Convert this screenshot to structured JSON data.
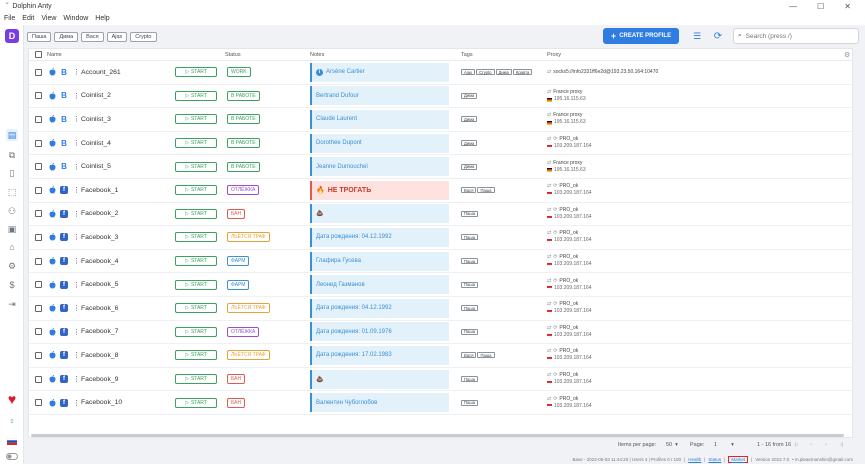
{
  "window": {
    "title": "Dolphin Anty",
    "min": "—",
    "max": "☐",
    "close": "✕"
  },
  "menu": [
    "File",
    "Edit",
    "View",
    "Window",
    "Help"
  ],
  "sidebar": {
    "logo": "D"
  },
  "toolbar": {
    "tag_filters": [
      "Паша",
      "Дима",
      "Вася",
      "Ajax",
      "Crypto"
    ],
    "create_label": "CREATE PROFILE",
    "search_placeholder": "Search (press /)"
  },
  "table": {
    "columns": {
      "name": "Name",
      "status": "Status",
      "notes": "Notes",
      "tags": "Tags",
      "proxy": "Proxy"
    },
    "start_label": "START",
    "rows": [
      {
        "name": "Account_261",
        "browser": "B",
        "status": "WORK",
        "status_color": "#3aa15f",
        "note": "Arsène Cartier",
        "note_icon": "info",
        "note_warn": false,
        "tags": [
          "Ajax",
          "Crypto",
          "Дима",
          "Кравта"
        ],
        "proxy_1": "socks5://info2331ff6e2d@193.23.50.164:10470",
        "proxy_2": "",
        "proxy_flag": "none"
      },
      {
        "name": "Coinlist_2",
        "browser": "B",
        "status": "В РАБОТЕ",
        "status_color": "#3aa15f",
        "note": "Bertrand Dufour",
        "note_icon": "",
        "note_warn": false,
        "tags": [
          "Дима"
        ],
        "proxy_1": "France proxy",
        "proxy_2": "195.16.115.63",
        "proxy_flag": "de"
      },
      {
        "name": "Coinlist_3",
        "browser": "B",
        "status": "В РАБОТЕ",
        "status_color": "#3aa15f",
        "note": "Claude Laurent",
        "note_icon": "",
        "note_warn": false,
        "tags": [
          "Дима"
        ],
        "proxy_1": "France proxy",
        "proxy_2": "195.16.115.63",
        "proxy_flag": "de"
      },
      {
        "name": "Coinlist_4",
        "browser": "B",
        "status": "В РАБОТЕ",
        "status_color": "#3aa15f",
        "note": "Dorothée Dupont",
        "note_icon": "",
        "note_warn": false,
        "tags": [
          "Дима"
        ],
        "proxy_1": "PRO_ok",
        "proxy_2": "103.209.187.164",
        "proxy_flag": "id"
      },
      {
        "name": "Coinlist_5",
        "browser": "B",
        "status": "В РАБОТЕ",
        "status_color": "#3aa15f",
        "note": "Jeanne Dumouchel",
        "note_icon": "",
        "note_warn": false,
        "tags": [
          "Дима"
        ],
        "proxy_1": "France proxy",
        "proxy_2": "195.16.115.63",
        "proxy_flag": "de"
      },
      {
        "name": "Facebook_1",
        "browser": "f",
        "status": "ОТЛЁЖКА",
        "status_color": "#9b4dca",
        "note": "НЕ ТРОГАТЬ",
        "note_icon": "fire",
        "note_warn": true,
        "tags": [
          "Вася",
          "Паша"
        ],
        "proxy_1": "PRO_ok",
        "proxy_2": "103.209.187.164",
        "proxy_flag": "id"
      },
      {
        "name": "Facebook_2",
        "browser": "f",
        "status": "БАН",
        "status_color": "#e25a4e",
        "note": "💩",
        "note_icon": "",
        "note_warn": false,
        "tags": [
          "Паша"
        ],
        "proxy_1": "PRO_ok",
        "proxy_2": "103.209.187.164",
        "proxy_flag": "id"
      },
      {
        "name": "Facebook_3",
        "browser": "f",
        "status": "ЛЬЁТСЯ ТРАФ",
        "status_color": "#e8a23a",
        "note": "Дата рождения: 04.12.1992",
        "note_icon": "",
        "note_warn": false,
        "tags": [
          "Паша"
        ],
        "proxy_1": "PRO_ok",
        "proxy_2": "103.209.187.164",
        "proxy_flag": "id"
      },
      {
        "name": "Facebook_4",
        "browser": "f",
        "status": "ФАРМ",
        "status_color": "#3a8fd6",
        "note": "Глафира Гусева",
        "note_icon": "",
        "note_warn": false,
        "tags": [
          "Паша"
        ],
        "proxy_1": "PRO_ok",
        "proxy_2": "103.209.187.164",
        "proxy_flag": "id"
      },
      {
        "name": "Facebook_5",
        "browser": "f",
        "status": "ФАРМ",
        "status_color": "#3a8fd6",
        "note": "Леонид Газманов",
        "note_icon": "",
        "note_warn": false,
        "tags": [
          "Паша"
        ],
        "proxy_1": "PRO_ok",
        "proxy_2": "103.209.187.164",
        "proxy_flag": "id"
      },
      {
        "name": "Facebook_6",
        "browser": "f",
        "status": "ЛЬЁТСЯ ТРАФ",
        "status_color": "#e8a23a",
        "note": "Дата рождения: 04.12.1992",
        "note_icon": "",
        "note_warn": false,
        "tags": [
          "Паша"
        ],
        "proxy_1": "PRO_ok",
        "proxy_2": "103.209.187.164",
        "proxy_flag": "id"
      },
      {
        "name": "Facebook_7",
        "browser": "f",
        "status": "ОТЛЁЖКА",
        "status_color": "#9b4dca",
        "note": "Дата рождения: 01.09.1976",
        "note_icon": "",
        "note_warn": false,
        "tags": [
          "Паша"
        ],
        "proxy_1": "PRO_ok",
        "proxy_2": "103.209.187.164",
        "proxy_flag": "id"
      },
      {
        "name": "Facebook_8",
        "browser": "f",
        "status": "ЛЬЁТСЯ ТРАФ",
        "status_color": "#e8a23a",
        "note": "Дата рождения: 17.02.1983",
        "note_icon": "",
        "note_warn": false,
        "tags": [
          "Вася",
          "Паша"
        ],
        "proxy_1": "PRO_ok",
        "proxy_2": "103.209.187.164",
        "proxy_flag": "id"
      },
      {
        "name": "Facebook_9",
        "browser": "f",
        "status": "БАН",
        "status_color": "#e25a4e",
        "note": "💩",
        "note_icon": "",
        "note_warn": false,
        "tags": [
          "Паша"
        ],
        "proxy_1": "PRO_ok",
        "proxy_2": "103.209.187.164",
        "proxy_flag": "id"
      },
      {
        "name": "Facebook_10",
        "browser": "f",
        "status": "БАН",
        "status_color": "#e25a4e",
        "note": "Валентин Чубоглобов",
        "note_icon": "",
        "note_warn": false,
        "tags": [
          "Паша"
        ],
        "proxy_1": "PRO_ok",
        "proxy_2": "103.209.187.164",
        "proxy_flag": "id"
      }
    ]
  },
  "pager": {
    "items_per_page_label": "Items per page:",
    "items_per_page": "50",
    "page_label": "Page:",
    "page": "1",
    "range": "1 - 16 from 16"
  },
  "statusbar": {
    "base": "Base - 2022-05-03 11:44:25 | Users 4 | Profiles 0 / 100",
    "health": "Health",
    "status": "Status",
    "market": "Market",
    "version": "Version 2022.7.0",
    "user": "• m.pleaemanshin@gmail.com"
  },
  "colors": {
    "accent": "#2f7de1",
    "brand": "#7a3ee0"
  }
}
